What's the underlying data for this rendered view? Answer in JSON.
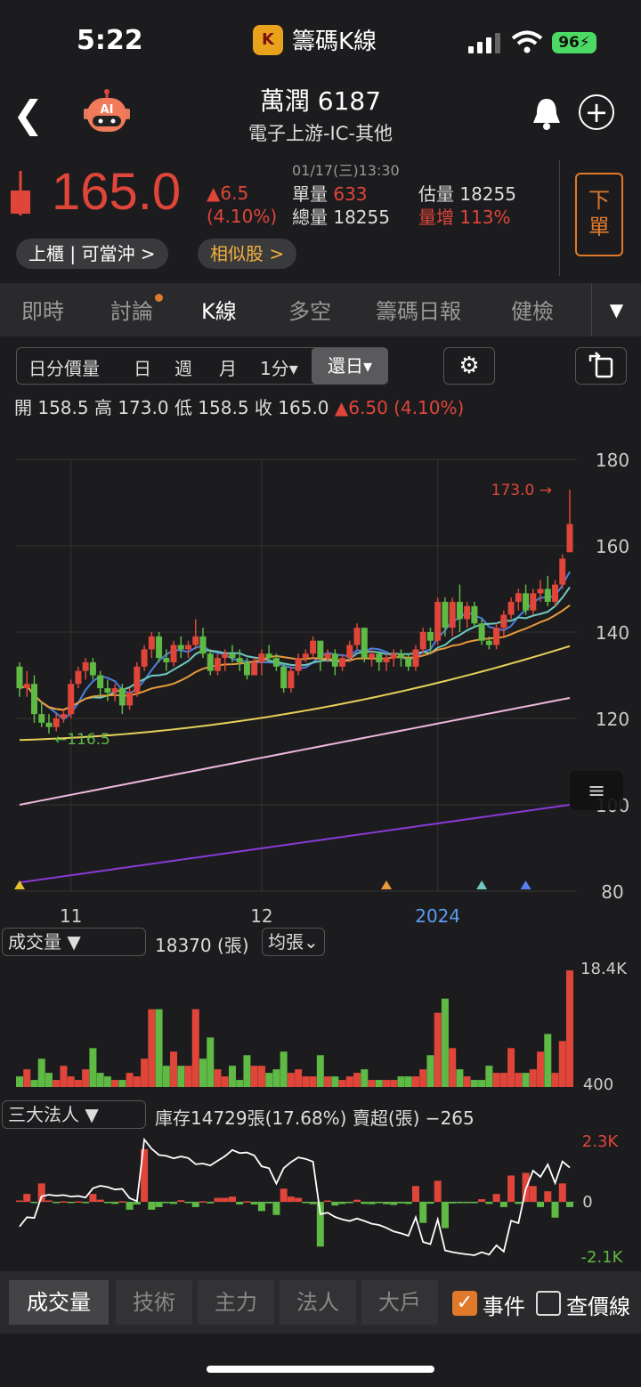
{
  "status": {
    "time": "5:22",
    "app_name": "籌碼K線",
    "app_logo_letter": "K",
    "battery": "96"
  },
  "header": {
    "stock_title": "萬潤 6187",
    "stock_sub": "電子上游-IC-其他",
    "ai_label": "AI"
  },
  "quote": {
    "price": "165.0",
    "change": "▲6.5",
    "change_pct": "(4.10%)",
    "datetime": "01/17(三)13:30",
    "unit_vol_label": "單量",
    "unit_vol": "633",
    "total_vol_label": "總量",
    "total_vol": "18255",
    "est_vol_label": "估量",
    "est_vol": "18255",
    "vol_inc_label": "量增",
    "vol_inc": "113%",
    "order_label_1": "下",
    "order_label_2": "單",
    "pill_market": "上櫃 | 可當沖 >",
    "pill_similar": "相似股 >"
  },
  "tabs": [
    {
      "label": "即時"
    },
    {
      "label": "討論"
    },
    {
      "label": "K線"
    },
    {
      "label": "多空"
    },
    {
      "label": "籌碼日報"
    },
    {
      "label": "健檢"
    }
  ],
  "periods": [
    "日分價量",
    "日",
    "週",
    "月",
    "1分▾",
    "還日▾"
  ],
  "ohlc": {
    "text": "開 158.5 高 173.0 低 158.5 收 165.0",
    "chg": "▲6.50 (4.10%)"
  },
  "price_chart": {
    "y_ticks": [
      "180",
      "160",
      "140",
      "120",
      "100",
      "80"
    ],
    "x_ticks": [
      "11",
      "12",
      "2024"
    ],
    "high_label": "173.0 →",
    "low_label": "←116.5"
  },
  "volume_panel": {
    "selector": "成交量 ▼",
    "value": "18370 (張)",
    "avg": "均張⌄",
    "ymax": "18.4K",
    "ymin": "400"
  },
  "inst_panel": {
    "selector": "三大法人 ▼",
    "summary": "庫存14729張(17.68%)  賣超(張) −265",
    "ymax": "2.3K",
    "yzero": "0",
    "ymin": "-2.1K"
  },
  "bottom_tabs": [
    "成交量",
    "技術",
    "主力",
    "法人",
    "大戶"
  ],
  "checks": {
    "events": "事件",
    "price_line": "查價線"
  },
  "colors": {
    "up": "#e0453a",
    "down": "#5fb945",
    "accent": "#e07a2a"
  },
  "chart_data": [
    {
      "type": "candlestick",
      "title": "",
      "ylim": [
        80,
        180
      ],
      "x_ticks": [
        "11",
        "12",
        "2024"
      ],
      "candles": [
        [
          132,
          133,
          125,
          127
        ],
        [
          127,
          131,
          125,
          128
        ],
        [
          128,
          130,
          119,
          121
        ],
        [
          121,
          124,
          118,
          119
        ],
        [
          119,
          121,
          116.5,
          118
        ],
        [
          118,
          121,
          117,
          120
        ],
        [
          120,
          122,
          119,
          121
        ],
        [
          121,
          129,
          120,
          128
        ],
        [
          128,
          132,
          127,
          131
        ],
        [
          131,
          134,
          129,
          133
        ],
        [
          133,
          134,
          129,
          130
        ],
        [
          130,
          131,
          125,
          127
        ],
        [
          127,
          129,
          124,
          126
        ],
        [
          126,
          128,
          124,
          127
        ],
        [
          127,
          128,
          121,
          123
        ],
        [
          123,
          127,
          122,
          126
        ],
        [
          126,
          133,
          125,
          132
        ],
        [
          132,
          137,
          131,
          136
        ],
        [
          136,
          140,
          134,
          139
        ],
        [
          139,
          140,
          133,
          134
        ],
        [
          134,
          136,
          131,
          133
        ],
        [
          133,
          138,
          132,
          137
        ],
        [
          137,
          139,
          134,
          136
        ],
        [
          136,
          138,
          134,
          137
        ],
        [
          137,
          143,
          136,
          139
        ],
        [
          139,
          141,
          134,
          135
        ],
        [
          135,
          136,
          130,
          131
        ],
        [
          131,
          135,
          130,
          134
        ],
        [
          134,
          136,
          131,
          135
        ],
        [
          135,
          137,
          133,
          134
        ],
        [
          134,
          136,
          131,
          133
        ],
        [
          133,
          134,
          129,
          130
        ],
        [
          130,
          134,
          130,
          133
        ],
        [
          133,
          136,
          130,
          135
        ],
        [
          135,
          137,
          133,
          134
        ],
        [
          134,
          135,
          131,
          132
        ],
        [
          132,
          133,
          126,
          127
        ],
        [
          127,
          132,
          126,
          131
        ],
        [
          131,
          135,
          130,
          134
        ],
        [
          134,
          136,
          133,
          135
        ],
        [
          135,
          139,
          134,
          138
        ],
        [
          138,
          138,
          131,
          134
        ],
        [
          134,
          136,
          133,
          135
        ],
        [
          135,
          136,
          130,
          132
        ],
        [
          132,
          135,
          131,
          134
        ],
        [
          134,
          138,
          133,
          137
        ],
        [
          137,
          142,
          136,
          141
        ],
        [
          141,
          141,
          133,
          134
        ],
        [
          134,
          136,
          132,
          135
        ],
        [
          135,
          135,
          131,
          133
        ],
        [
          133,
          135,
          131,
          134
        ],
        [
          134,
          136,
          132,
          135
        ],
        [
          135,
          136,
          132,
          134
        ],
        [
          134,
          135,
          131,
          132
        ],
        [
          132,
          137,
          131,
          136
        ],
        [
          136,
          141,
          135,
          140
        ],
        [
          140,
          141,
          135,
          138
        ],
        [
          138,
          148,
          137,
          147
        ],
        [
          147,
          148,
          139,
          141
        ],
        [
          141,
          148,
          139,
          147
        ],
        [
          147,
          151,
          140,
          143
        ],
        [
          143,
          147,
          141,
          146
        ],
        [
          146,
          147,
          141,
          142
        ],
        [
          142,
          143,
          137,
          138
        ],
        [
          138,
          139,
          136,
          137
        ],
        [
          137,
          142,
          136,
          141
        ],
        [
          141,
          145,
          139,
          144
        ],
        [
          144,
          148,
          143,
          147
        ],
        [
          147,
          150,
          145,
          149
        ],
        [
          149,
          151,
          144,
          145
        ],
        [
          145,
          150,
          144,
          149
        ],
        [
          149,
          152,
          147,
          150
        ],
        [
          150,
          153,
          146,
          147
        ],
        [
          147,
          152,
          146,
          151
        ],
        [
          151,
          158,
          150,
          157
        ],
        [
          158.5,
          173,
          158.5,
          165
        ]
      ]
    },
    {
      "type": "bar",
      "title": "成交量",
      "values": [
        3,
        5,
        2,
        8,
        4,
        2,
        6,
        3,
        2,
        5,
        11,
        4,
        3,
        2,
        2,
        4,
        3,
        8,
        22,
        22,
        6,
        10,
        6,
        6,
        22,
        8,
        14,
        5,
        3,
        6,
        2,
        9,
        6,
        6,
        4,
        5,
        10,
        4,
        5,
        3,
        3,
        9,
        3,
        3,
        2,
        3,
        4,
        5,
        2,
        2,
        2,
        2,
        3,
        3,
        3,
        5,
        9,
        21,
        25,
        11,
        5,
        3,
        2,
        2,
        6,
        4,
        4,
        11,
        4,
        4,
        5,
        10,
        15,
        4,
        13,
        33
      ]
    },
    {
      "type": "bar",
      "title": "三大法人",
      "values": [
        50,
        300,
        -20,
        700,
        50,
        -30,
        20,
        -50,
        20,
        -50,
        300,
        80,
        -40,
        -80,
        20,
        -300,
        -100,
        2000,
        -300,
        -200,
        -30,
        -80,
        60,
        -50,
        -200,
        20,
        -60,
        150,
        150,
        200,
        -100,
        20,
        -100,
        -350,
        -60,
        -500,
        500,
        200,
        150,
        -50,
        -90,
        -1700,
        50,
        -140,
        -80,
        -50,
        80,
        -80,
        -90,
        -40,
        -90,
        -120,
        -60,
        -80,
        600,
        -800,
        -70,
        800,
        -1000,
        -60,
        -40,
        -30,
        -30,
        100,
        -80,
        300,
        -200,
        1000,
        -80,
        1100,
        600,
        -200,
        400,
        -600,
        700,
        -200
      ],
      "cumulative_line": true
    }
  ]
}
